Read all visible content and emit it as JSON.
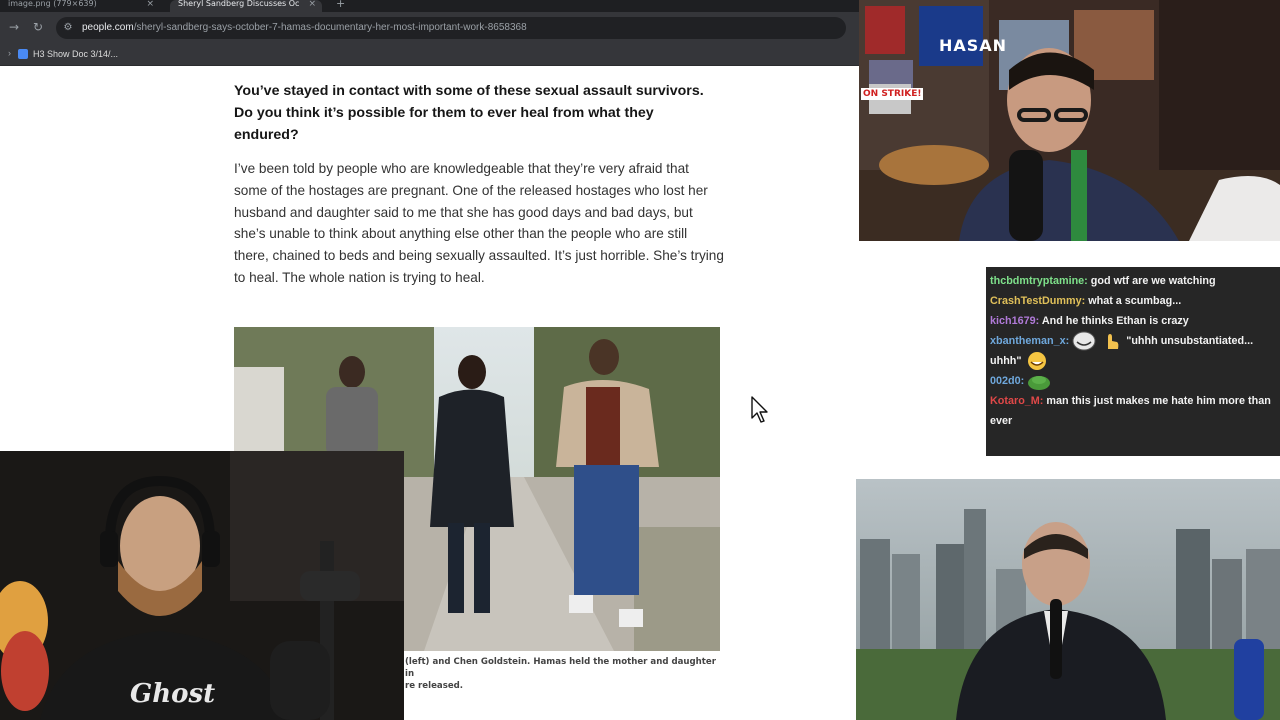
{
  "browser": {
    "tabs": [
      {
        "label": "image.png (779×639)",
        "active": false,
        "close": "×"
      },
      {
        "label": "Sheryl Sandberg Discusses Oc",
        "active": true,
        "close": "×"
      }
    ],
    "new_tab": "+",
    "url_host": "people.com",
    "url_path": "/sheryl-sandberg-says-october-7-hamas-documentary-her-most-important-work-8658368",
    "bookmark_label": "H3 Show Doc 3/14/..."
  },
  "article": {
    "question": "You’ve stayed in contact with some of these sexual assault survivors. Do you think it’s possible for them to ever heal from what they endured?",
    "answer": "I’ve been told by people who are knowledgeable that they’re very afraid that some of the hostages are pregnant. One of the released hostages who lost her husband and daughter said to me that she has good days and bad days, but she’s unable to think about anything else other than the people who are still there, chained to beds and being sexually assaulted. It’s just horrible. She’s trying to heal. The whole nation is trying to heal.",
    "caption_line1": "(left) and Chen Goldstein. Hamas held the mother and daughter in",
    "caption_line2": "re released."
  },
  "streams": {
    "hasan_banner": "HASAN",
    "hasan_sign": "ON STRIKE!",
    "asmon_shirt": "Ghost"
  },
  "chat": {
    "messages": [
      {
        "user": "thcbdmtryptamine:",
        "text": " god wtf are we watching",
        "color": "#7ee08a"
      },
      {
        "user": "CrashTestDummy:",
        "text": " what a scumbag...",
        "color": "#e0c05a"
      },
      {
        "user": "kich1679:",
        "text": " And he thinks Ethan is crazy",
        "color": "#b07ad8"
      },
      {
        "user": "xbantheman_x:",
        "text": " \"uhhh unsubstantiated... uhhh\"",
        "color": "#6fa8dc"
      },
      {
        "user": "002d0:",
        "text": "",
        "color": "#6fa8dc"
      },
      {
        "user": "Kotaro_M:",
        "text": " man this just makes me hate him more than ever",
        "color": "#e04848"
      }
    ]
  },
  "colors": {
    "chrome_bg": "#35363a",
    "omnibox_bg": "#202124",
    "chat_bg": "#141414"
  }
}
